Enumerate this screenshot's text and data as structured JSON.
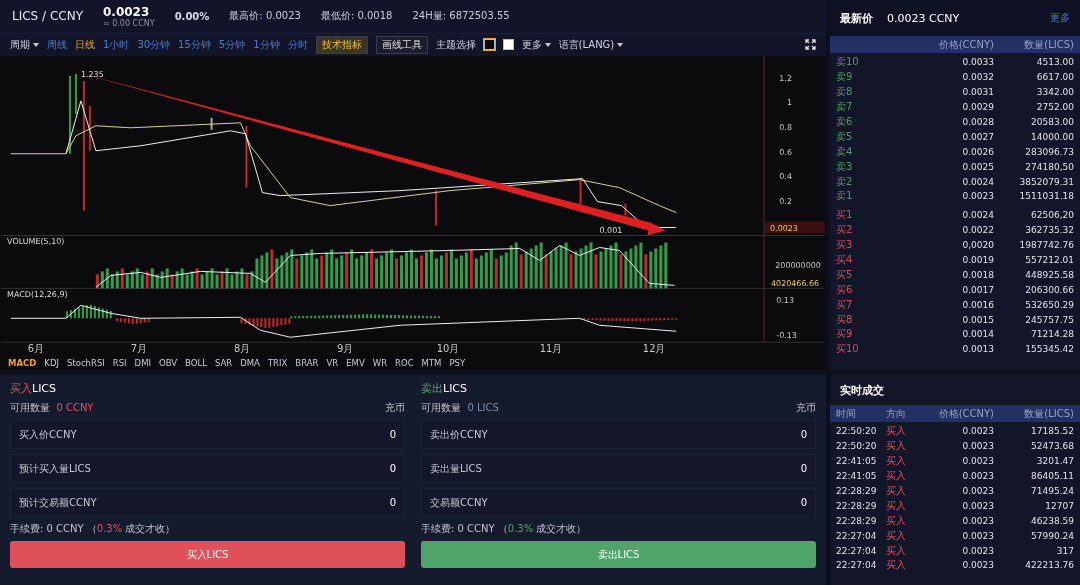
{
  "header": {
    "pair": "LICS / CCNY",
    "price": "0.0023",
    "price_cny": "≈ 0.00  CCNY",
    "change": "0.00%",
    "stats": [
      {
        "label": "最高价:",
        "value": "0.0023"
      },
      {
        "label": "最低价:",
        "value": "0.0018"
      },
      {
        "label": "24H量:",
        "value": "6872503.55"
      }
    ]
  },
  "toolbar": {
    "period_label": "周期",
    "periods": [
      {
        "label": "周线",
        "selected": false
      },
      {
        "label": "日线",
        "selected": true
      },
      {
        "label": "1小时",
        "selected": false
      },
      {
        "label": "30分钟",
        "selected": false
      },
      {
        "label": "15分钟",
        "selected": false
      },
      {
        "label": "5分钟",
        "selected": false
      },
      {
        "label": "1分钟",
        "selected": false
      },
      {
        "label": "分时",
        "selected": false
      }
    ],
    "tools": [
      {
        "label": "技术指标",
        "selected": true
      },
      {
        "label": "画线工具",
        "selected": false
      }
    ],
    "theme_label": "主题选择",
    "themes": [
      {
        "color": "#0b0b0d",
        "selected": true
      },
      {
        "color": "#ffffff",
        "selected": false
      }
    ],
    "more": "更多",
    "language": "语言(LANG)"
  },
  "chart": {
    "price_ticks": [
      "1.2",
      "1",
      "0.8",
      "0.6",
      "0.4",
      "0.2"
    ],
    "high_tag": "1.235",
    "low_tag": "0.001",
    "last_tag": "0.0023",
    "volume_title": "VOLUME(5,10)",
    "volume_tick": "200000000",
    "volume_tag": "4020466.66",
    "macd_title": "MACD(12,26,9)",
    "macd_ticks": [
      "0.13",
      "-0.13"
    ],
    "months": [
      "6月",
      "7月",
      "8月",
      "9月",
      "10月",
      "11月",
      "12月"
    ]
  },
  "indicators": [
    {
      "label": "MACD",
      "selected": true
    },
    {
      "label": "KDJ",
      "selected": false
    },
    {
      "label": "StochRSI",
      "selected": false
    },
    {
      "label": "RSI",
      "selected": false
    },
    {
      "label": "DMI",
      "selected": false
    },
    {
      "label": "OBV",
      "selected": false
    },
    {
      "label": "BOLL",
      "selected": false
    },
    {
      "label": "SAR",
      "selected": false
    },
    {
      "label": "DMA",
      "selected": false
    },
    {
      "label": "TRIX",
      "selected": false
    },
    {
      "label": "BRAR",
      "selected": false
    },
    {
      "label": "VR",
      "selected": false
    },
    {
      "label": "EMV",
      "selected": false
    },
    {
      "label": "WR",
      "selected": false
    },
    {
      "label": "ROC",
      "selected": false
    },
    {
      "label": "MTM",
      "selected": false
    },
    {
      "label": "PSY",
      "selected": false
    }
  ],
  "forms": [
    {
      "kind": "buy",
      "action": "买入",
      "asset": "LICS",
      "available_label": "可用数量",
      "available": "0  CCNY",
      "recharge": "充币",
      "fields": [
        {
          "label": "买入价CCNY",
          "value": "0"
        },
        {
          "label": "预计买入量LICS",
          "value": "0"
        },
        {
          "label": "预计交易额CCNY",
          "value": "0"
        }
      ],
      "fee_prefix": "手续费:  0  CCNY  （",
      "fee_rate": "0.3%",
      "fee_suffix": " 成交才收）",
      "button": "买入LICS"
    },
    {
      "kind": "sell",
      "action": "卖出",
      "asset": "LICS",
      "available_label": "可用数量",
      "available": "0 LICS",
      "recharge": "充币",
      "fields": [
        {
          "label": "卖出价CCNY",
          "value": "0"
        },
        {
          "label": "卖出量LICS",
          "value": "0"
        },
        {
          "label": "交易额CCNY",
          "value": "0"
        }
      ],
      "fee_prefix": "手续费:  0  CCNY  （",
      "fee_rate": "0.3%",
      "fee_suffix": " 成交才收）",
      "button": "卖出LICS"
    }
  ],
  "order_book": {
    "title": "最新价",
    "price": "0.0023 CCNY",
    "more": "更多",
    "columns": [
      "价格(CCNY)",
      "数量(LICS)"
    ],
    "asks": [
      {
        "label": "卖10",
        "price": "0.0033",
        "amount": "4513.00"
      },
      {
        "label": "卖9",
        "price": "0.0032",
        "amount": "6617.00"
      },
      {
        "label": "卖8",
        "price": "0.0031",
        "amount": "3342.00"
      },
      {
        "label": "卖7",
        "price": "0.0029",
        "amount": "2752.00"
      },
      {
        "label": "卖6",
        "price": "0.0028",
        "amount": "20583.00"
      },
      {
        "label": "卖5",
        "price": "0.0027",
        "amount": "14000.00"
      },
      {
        "label": "卖4",
        "price": "0.0026",
        "amount": "283096.73"
      },
      {
        "label": "卖3",
        "price": "0.0025",
        "amount": "274180,50"
      },
      {
        "label": "卖2",
        "price": "0.0024",
        "amount": "3852079.31"
      },
      {
        "label": "卖1",
        "price": "0.0023",
        "amount": "1511031.18"
      }
    ],
    "bids": [
      {
        "label": "买1",
        "price": "0.0024",
        "amount": "62506,20"
      },
      {
        "label": "买2",
        "price": "0.0022",
        "amount": "362735.32"
      },
      {
        "label": "买3",
        "price": "0,0020",
        "amount": "1987742.76"
      },
      {
        "label": "买4",
        "price": "0.0019",
        "amount": "557212.01"
      },
      {
        "label": "买5",
        "price": "0.0018",
        "amount": "448925.58"
      },
      {
        "label": "买6",
        "price": "0.0017",
        "amount": "206300.66"
      },
      {
        "label": "买7",
        "price": "0.0016",
        "amount": "532650.29"
      },
      {
        "label": "买8",
        "price": "0.0015",
        "amount": "245757.75"
      },
      {
        "label": "买9",
        "price": "0.0014",
        "amount": "71214.28"
      },
      {
        "label": "买10",
        "price": "0.0013",
        "amount": "155345.42"
      }
    ]
  },
  "trades": {
    "title": "实时成交",
    "columns": [
      "时间",
      "方向",
      "价格(CCNY)",
      "数量(LICS)"
    ],
    "rows": [
      {
        "time": "22:50:20",
        "side": "买入",
        "kind": "buy",
        "price": "0.0023",
        "amount": "17185.52"
      },
      {
        "time": "22:50:20",
        "side": "买入",
        "kind": "buy",
        "price": "0.0023",
        "amount": "52473.68"
      },
      {
        "time": "22:41:05",
        "side": "买入",
        "kind": "buy",
        "price": "0.0023",
        "amount": "3201.47"
      },
      {
        "time": "22:41:05",
        "side": "买入",
        "kind": "buy",
        "price": "0.0023",
        "amount": "86405.11"
      },
      {
        "time": "22:28:29",
        "side": "买入",
        "kind": "buy",
        "price": "0.0023",
        "amount": "71495.24"
      },
      {
        "time": "22:28:29",
        "side": "买入",
        "kind": "buy",
        "price": "0.0023",
        "amount": "12707"
      },
      {
        "time": "22:28:29",
        "side": "买入",
        "kind": "buy",
        "price": "0.0023",
        "amount": "46238.59"
      },
      {
        "time": "22:27:04",
        "side": "买入",
        "kind": "buy",
        "price": "0.0023",
        "amount": "57990.24"
      },
      {
        "time": "22:27:04",
        "side": "买入",
        "kind": "buy",
        "price": "0.0023",
        "amount": "317"
      },
      {
        "time": "22:27:04",
        "side": "买入",
        "kind": "buy",
        "price": "0.0023",
        "amount": "422213.76"
      }
    ]
  }
}
